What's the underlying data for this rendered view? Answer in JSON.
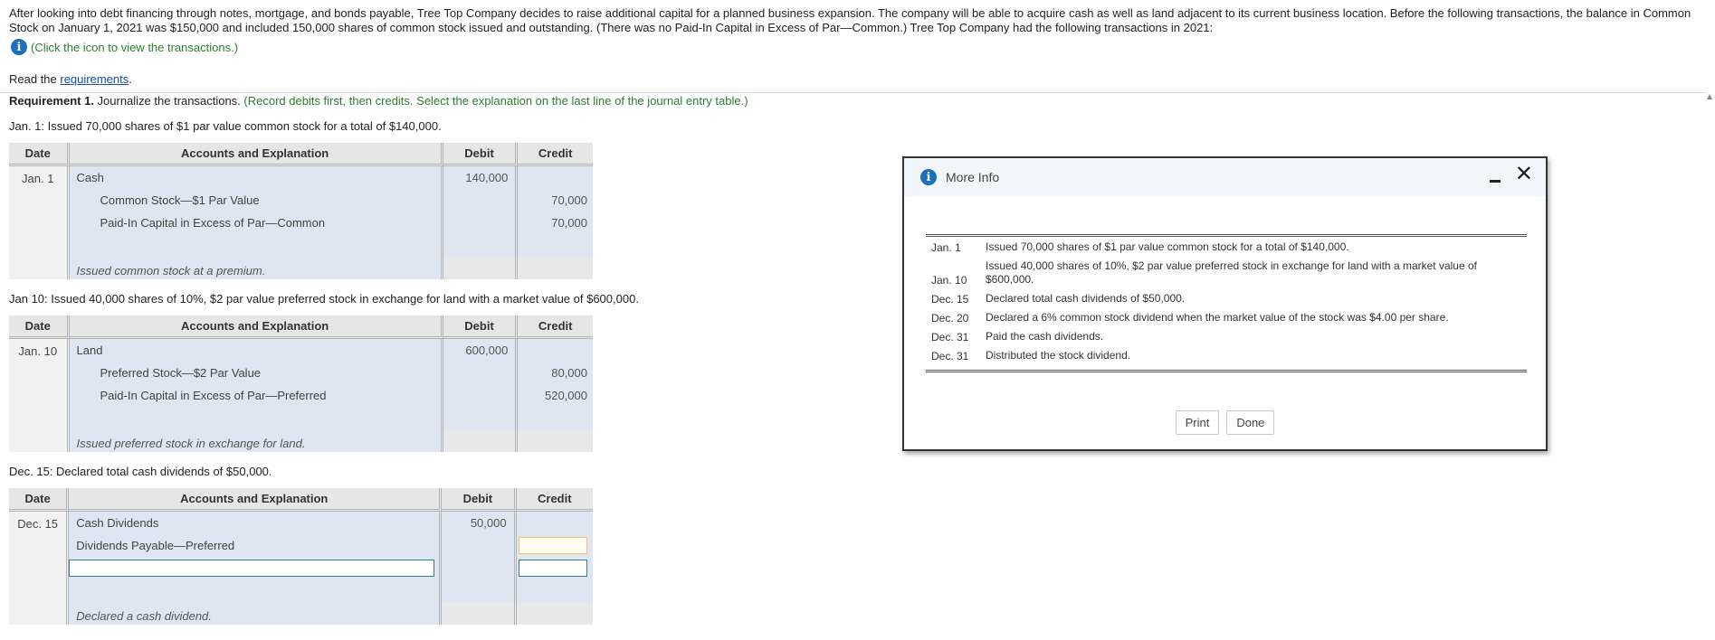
{
  "intro": {
    "text": "After looking into debt financing through notes, mortgage, and bonds payable, Tree Top Company decides to raise additional capital for a planned business expansion. The company will be able to acquire cash as well as land adjacent to its current business location. Before the following transactions, the balance in Common Stock on January 1, 2021 was $150,000 and included 150,000 shares of common stock issued and outstanding. (There was no Paid-In Capital in Excess of Par—Common.) Tree Top Company had the following transactions in 2021:",
    "info_icon": "info-icon",
    "info_link": "(Click the icon to view the transactions.)"
  },
  "read": {
    "prefix": "Read the ",
    "link": "requirements",
    "suffix": "."
  },
  "requirement": {
    "label": "Requirement 1.",
    "text": " Journalize the transactions. ",
    "hint": "(Record debits first, then credits. Select the explanation on the last line of the journal entry table.)"
  },
  "headers": {
    "date": "Date",
    "account": "Accounts and Explanation",
    "debit": "Debit",
    "credit": "Credit"
  },
  "entry1": {
    "scenario": "Jan. 1: Issued 70,000 shares of $1 par value common stock for a total of $140,000.",
    "date": "Jan. 1",
    "rows": [
      {
        "account": "Cash",
        "debit": "140,000",
        "credit": ""
      },
      {
        "account": "Common Stock—$1 Par Value",
        "debit": "",
        "credit": "70,000"
      },
      {
        "account": "Paid-In Capital in Excess of Par—Common",
        "debit": "",
        "credit": "70,000"
      }
    ],
    "explanation": "Issued common stock at a premium."
  },
  "entry2": {
    "scenario": "Jan 10: Issued 40,000 shares of 10%, $2 par value preferred stock in exchange for land with a market value of $600,000.",
    "date": "Jan. 10",
    "rows": [
      {
        "account": "Land",
        "debit": "600,000",
        "credit": ""
      },
      {
        "account": "Preferred Stock—$2 Par Value",
        "debit": "",
        "credit": "80,000"
      },
      {
        "account": "Paid-In Capital in Excess of Par—Preferred",
        "debit": "",
        "credit": "520,000"
      }
    ],
    "explanation": "Issued preferred stock in exchange for land."
  },
  "entry3": {
    "scenario": "Dec. 15: Declared total cash dividends of $50,000.",
    "date": "Dec. 15",
    "rows": [
      {
        "account": "Cash Dividends",
        "debit": "50,000",
        "credit": ""
      },
      {
        "account": "Dividends Payable—Preferred",
        "debit": "",
        "credit": ""
      }
    ],
    "explanation": "Declared a cash dividend."
  },
  "modal": {
    "title": "More Info",
    "icon": "info-icon",
    "close": "✕",
    "transactions": [
      {
        "date": "Jan. 1",
        "text": "Issued 70,000 shares of $1 par value common stock for a total of $140,000."
      },
      {
        "date": "Jan. 10",
        "text": "Issued 40,000 shares of 10%, $2 par value preferred stock in exchange for land with a market value of $600,000."
      },
      {
        "date": "Dec. 15",
        "text": "Declared total cash dividends of $50,000."
      },
      {
        "date": "Dec. 20",
        "text": "Declared a 6% common stock dividend when the market value of the stock was $4.00 per share."
      },
      {
        "date": "Dec. 31",
        "text": "Paid the cash dividends."
      },
      {
        "date": "Dec. 31",
        "text": "Distributed the stock dividend."
      }
    ],
    "print_label": "Print",
    "done_label": "Done"
  },
  "colors": {
    "accent_blue": "#1f6fbf",
    "hint_green": "#2e7d32",
    "cell_blue": "#dde6f1"
  }
}
